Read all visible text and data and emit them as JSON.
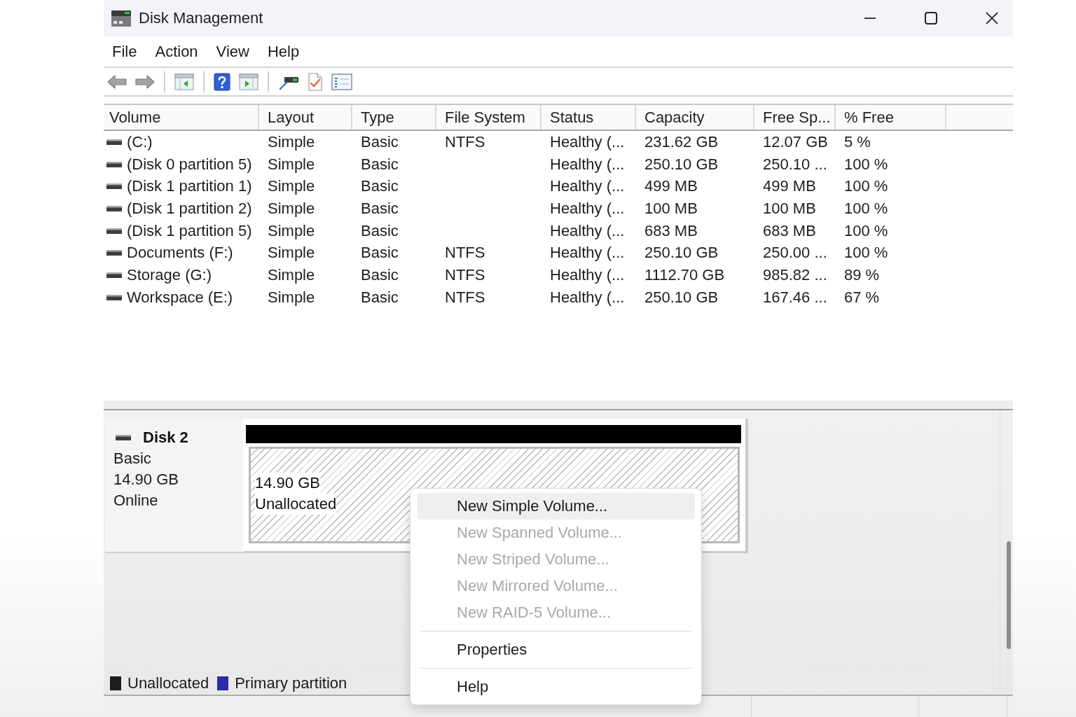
{
  "window": {
    "title": "Disk Management"
  },
  "menu_bar": [
    "File",
    "Action",
    "View",
    "Help"
  ],
  "volume_table": {
    "columns": [
      "Volume",
      "Layout",
      "Type",
      "File System",
      "Status",
      "Capacity",
      "Free Sp...",
      "% Free"
    ],
    "rows": [
      {
        "volume": "(C:)",
        "layout": "Simple",
        "type": "Basic",
        "file_system": "NTFS",
        "status": "Healthy (...",
        "capacity": "231.62 GB",
        "free_space": "12.07 GB",
        "percent_free": "5 %"
      },
      {
        "volume": "(Disk 0 partition 5)",
        "layout": "Simple",
        "type": "Basic",
        "status": "Healthy (...",
        "capacity": "250.10 GB",
        "free_space": "250.10 ...",
        "percent_free": "100 %"
      },
      {
        "volume": "(Disk 1 partition 1)",
        "layout": "Simple",
        "type": "Basic",
        "status": "Healthy (...",
        "capacity": "499 MB",
        "free_space": "499 MB",
        "percent_free": "100 %"
      },
      {
        "volume": "(Disk 1 partition 2)",
        "layout": "Simple",
        "type": "Basic",
        "status": "Healthy (...",
        "capacity": "100 MB",
        "free_space": "100 MB",
        "percent_free": "100 %"
      },
      {
        "volume": "(Disk 1 partition 5)",
        "layout": "Simple",
        "type": "Basic",
        "status": "Healthy (...",
        "capacity": "683 MB",
        "free_space": "683 MB",
        "percent_free": "100 %"
      },
      {
        "volume": "Documents (F:)",
        "layout": "Simple",
        "type": "Basic",
        "file_system": "NTFS",
        "status": "Healthy (...",
        "capacity": "250.10 GB",
        "free_space": "250.00 ...",
        "percent_free": "100 %"
      },
      {
        "volume": "Storage (G:)",
        "layout": "Simple",
        "type": "Basic",
        "file_system": "NTFS",
        "status": "Healthy (...",
        "capacity": "1112.70 GB",
        "free_space": "985.82 ...",
        "percent_free": "89 %"
      },
      {
        "volume": "Workspace (E:)",
        "layout": "Simple",
        "type": "Basic",
        "file_system": "NTFS",
        "status": "Healthy (...",
        "capacity": "250.10 GB",
        "free_space": "167.46 ...",
        "percent_free": "67 %"
      }
    ]
  },
  "disks": [
    {
      "name": "Disk 2",
      "type": "Basic",
      "size": "14.90 GB",
      "status": "Online",
      "partitions": [
        {
          "kind": "unallocated",
          "size": "14.90 GB",
          "label": "Unallocated"
        }
      ]
    }
  ],
  "legend": [
    {
      "label": "Unallocated",
      "color": "#1e1e1e"
    },
    {
      "label": "Primary partition",
      "color": "#2b2ba6"
    }
  ],
  "context_menu": {
    "groups": [
      [
        {
          "label": "New Simple Volume...",
          "disabled": false,
          "selected": true
        },
        {
          "label": "New Spanned Volume...",
          "disabled": true,
          "selected": false
        },
        {
          "label": "New Striped Volume...",
          "disabled": true,
          "selected": false
        },
        {
          "label": "New Mirrored Volume...",
          "disabled": true,
          "selected": false
        },
        {
          "label": "New RAID-5 Volume...",
          "disabled": true,
          "selected": false
        }
      ],
      [
        {
          "label": "Properties",
          "disabled": false,
          "selected": false
        }
      ],
      [
        {
          "label": "Help",
          "disabled": false,
          "selected": false
        }
      ]
    ]
  }
}
